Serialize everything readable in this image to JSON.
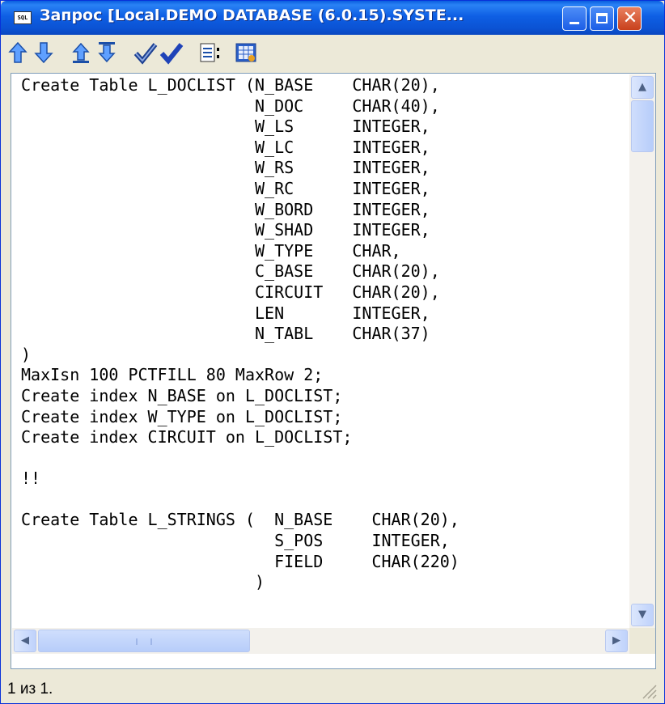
{
  "window": {
    "title": "Запрос [Local.DEMO DATABASE (6.0.15).SYSTE...",
    "icon_label": "SQL"
  },
  "toolbar": {
    "buttons": [
      "move-up-icon",
      "move-down-icon",
      "move-first-icon",
      "move-last-icon",
      "check-syntax-icon",
      "execute-checkmark-icon",
      "explain-plan-icon",
      "results-grid-icon"
    ]
  },
  "editor": {
    "lines": [
      "Create Table L_DOCLIST (N_BASE    CHAR(20),",
      "                        N_DOC     CHAR(40),",
      "                        W_LS      INTEGER,",
      "                        W_LC      INTEGER,",
      "                        W_RS      INTEGER,",
      "                        W_RC      INTEGER,",
      "                        W_BORD    INTEGER,",
      "                        W_SHAD    INTEGER,",
      "                        W_TYPE    CHAR,",
      "                        C_BASE    CHAR(20),",
      "                        CIRCUIT   CHAR(20),",
      "                        LEN       INTEGER,",
      "                        N_TABL    CHAR(37)",
      ")",
      "MaxIsn 100 PCTFILL 80 MaxRow 2;",
      "Create index N_BASE on L_DOCLIST;",
      "Create index W_TYPE on L_DOCLIST;",
      "Create index CIRCUIT on L_DOCLIST;",
      "",
      "!!",
      "",
      "Create Table L_STRINGS (  N_BASE    CHAR(20),",
      "                          S_POS     INTEGER,",
      "                          FIELD     CHAR(220)",
      "                        )"
    ]
  },
  "status": {
    "text": "1 из 1."
  }
}
